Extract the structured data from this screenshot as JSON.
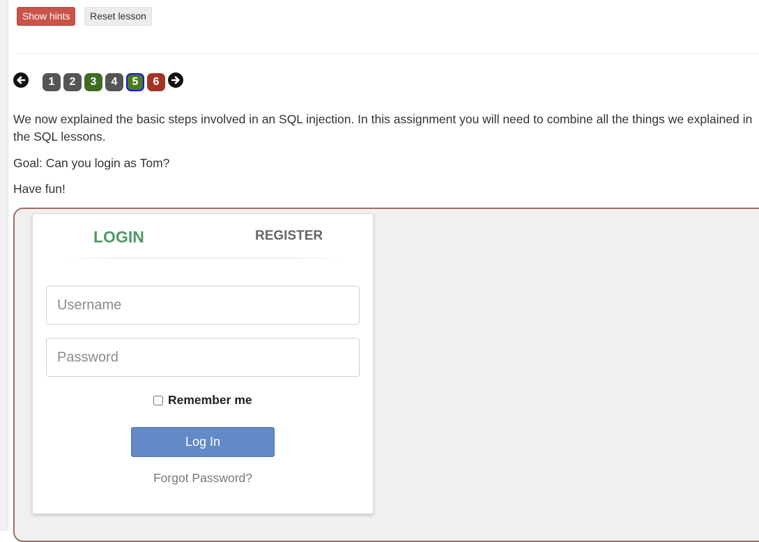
{
  "toolbar": {
    "show_hints_label": "Show hints",
    "reset_lesson_label": "Reset lesson"
  },
  "pagination": {
    "pages": [
      "1",
      "2",
      "3",
      "4",
      "5",
      "6"
    ],
    "current": "5"
  },
  "lesson": {
    "intro": "We now explained the basic steps involved in an SQL injection. In this assignment you will need to combine all the things we explained in the SQL lessons.",
    "goal": "Goal: Can you login as Tom?",
    "closing": "Have fun!"
  },
  "form": {
    "tabs": {
      "login": "LOGIN",
      "register": "REGISTER"
    },
    "username_placeholder": "Username",
    "password_placeholder": "Password",
    "remember_label": "Remember me",
    "login_button": "Log In",
    "forgot_link": "Forgot Password?"
  },
  "colors": {
    "hints_button": "#c9524a",
    "page_grey": "#555555",
    "page_green": "#3f6c22",
    "page_red": "#a23426",
    "current_page_border": "#1515e0",
    "login_tab": "#4f9a63",
    "login_button": "#6389c6"
  },
  "icons": [
    "arrow-left-icon",
    "arrow-right-icon"
  ]
}
